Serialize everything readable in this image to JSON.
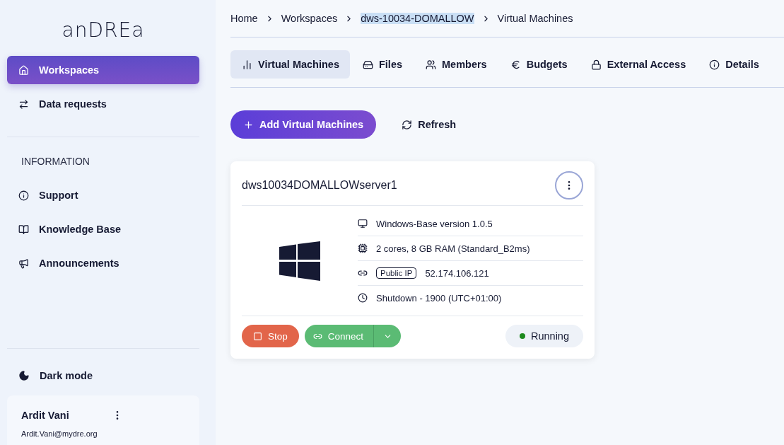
{
  "sidebar": {
    "logo": "anDREa",
    "nav": [
      {
        "label": "Workspaces",
        "selected": true
      },
      {
        "label": "Data requests",
        "selected": false
      }
    ],
    "section_title": "INFORMATION",
    "info_items": [
      {
        "label": "Support"
      },
      {
        "label": "Knowledge Base"
      },
      {
        "label": "Announcements"
      }
    ],
    "dark_mode": {
      "label": "Dark mode"
    },
    "user": {
      "name": "Ardit Vani",
      "email": "Ardit.Vani@mydre.org"
    }
  },
  "breadcrumbs": [
    {
      "label": "Home",
      "highlighted": false
    },
    {
      "label": "Workspaces",
      "highlighted": false
    },
    {
      "label": "dws-10034-DOMALLOW",
      "highlighted": true
    },
    {
      "label": "Virtual Machines",
      "highlighted": false
    }
  ],
  "tabs": [
    {
      "label": "Virtual Machines",
      "selected": true
    },
    {
      "label": "Files",
      "selected": false
    },
    {
      "label": "Members",
      "selected": false
    },
    {
      "label": "Budgets",
      "selected": false
    },
    {
      "label": "External Access",
      "selected": false
    },
    {
      "label": "Details",
      "selected": false
    }
  ],
  "actions": {
    "add": "Add Virtual Machines",
    "refresh": "Refresh"
  },
  "vm": {
    "name": "dws10034DOMALLOWserver1",
    "specs": [
      {
        "kind": "image",
        "text": "Windows-Base version 1.0.5"
      },
      {
        "kind": "size",
        "text": "2 cores, 8 GB RAM (Standard_B2ms)"
      },
      {
        "kind": "ip",
        "badge": "Public IP",
        "text": "52.174.106.121"
      },
      {
        "kind": "shutdown",
        "text": "Shutdown -  1900  (UTC+01:00)"
      }
    ],
    "stop": "Stop",
    "connect": "Connect",
    "status": {
      "label": "Running",
      "color": "#1e8a1e"
    }
  }
}
